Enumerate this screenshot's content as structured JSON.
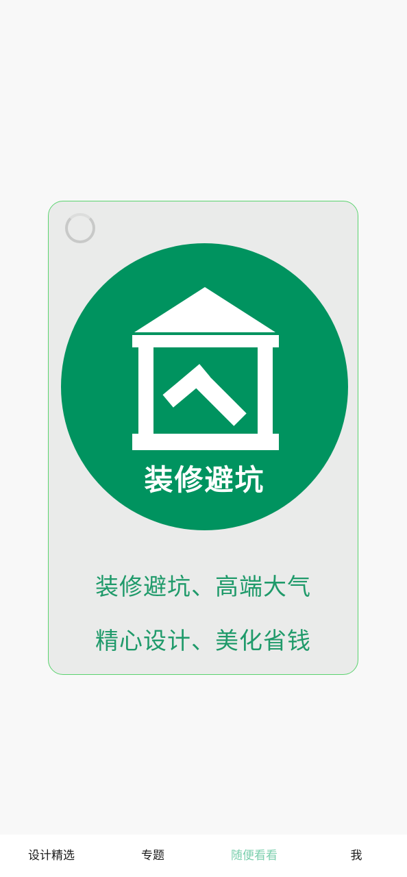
{
  "colors": {
    "background": "#f8f8f8",
    "card_background": "#eaebea",
    "card_border": "#5ad36e",
    "logo_green": "#00935f",
    "slogan_text": "#1f9a6a",
    "tab_active": "#7ccfae",
    "tab_text": "#1a1a1a"
  },
  "card": {
    "loading_icon": "loading-spinner-icon",
    "logo": {
      "icon": "house-hammer-icon",
      "text": "装修避坑"
    },
    "slogan_line1": "装修避坑、高端大气",
    "slogan_line2": "精心设计、美化省钱"
  },
  "tabbar": {
    "tabs": [
      {
        "label": "设计精选",
        "active": false
      },
      {
        "label": "专题",
        "active": false
      },
      {
        "label": "随便看看",
        "active": true
      },
      {
        "label": "我",
        "active": false
      }
    ]
  }
}
